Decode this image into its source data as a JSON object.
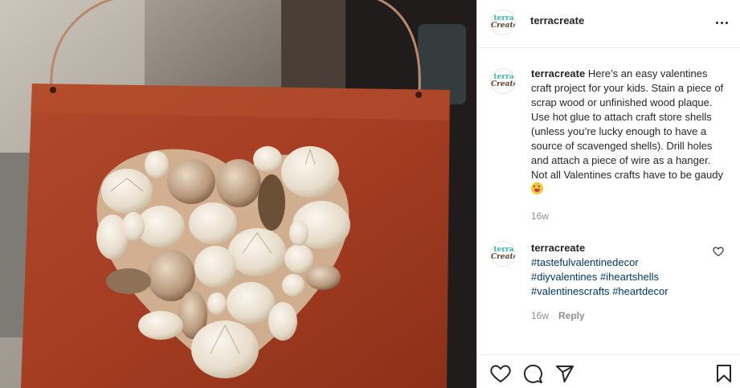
{
  "post": {
    "username": "terracreate",
    "avatar_text": [
      "terra",
      "Create"
    ],
    "more_icon": "more-horizontal-icon",
    "image_alt": "Shell heart craft on stained wood plaque"
  },
  "caption": {
    "username": "terracreate",
    "text": "Here’s an easy valentines craft project for your kids. Stain a piece of scrap wood or unfinished wood plaque. Use hot glue to attach craft store shells (unless you’re lucky enough to have a source of scavenged shells). Drill holes and attach a piece of wire as a hanger. Not all Valentines crafts have to be gaudy",
    "emoji": "tongue-out-emoji",
    "time": "16w"
  },
  "comment": {
    "username": "terracreate",
    "hashtags": [
      "#tastefulvalentinedecor",
      "#diyvalentines",
      "#iheartshells",
      "#valentinescrafts",
      "#heartdecor"
    ],
    "time": "16w",
    "reply_label": "Reply"
  },
  "actions": {
    "icons": [
      "heart-icon",
      "comment-icon",
      "share-icon",
      "bookmark-icon"
    ]
  },
  "colors": {
    "hashtag": "#00376b",
    "meta": "#8e8e8e",
    "text": "#262626",
    "border": "#efefef"
  }
}
